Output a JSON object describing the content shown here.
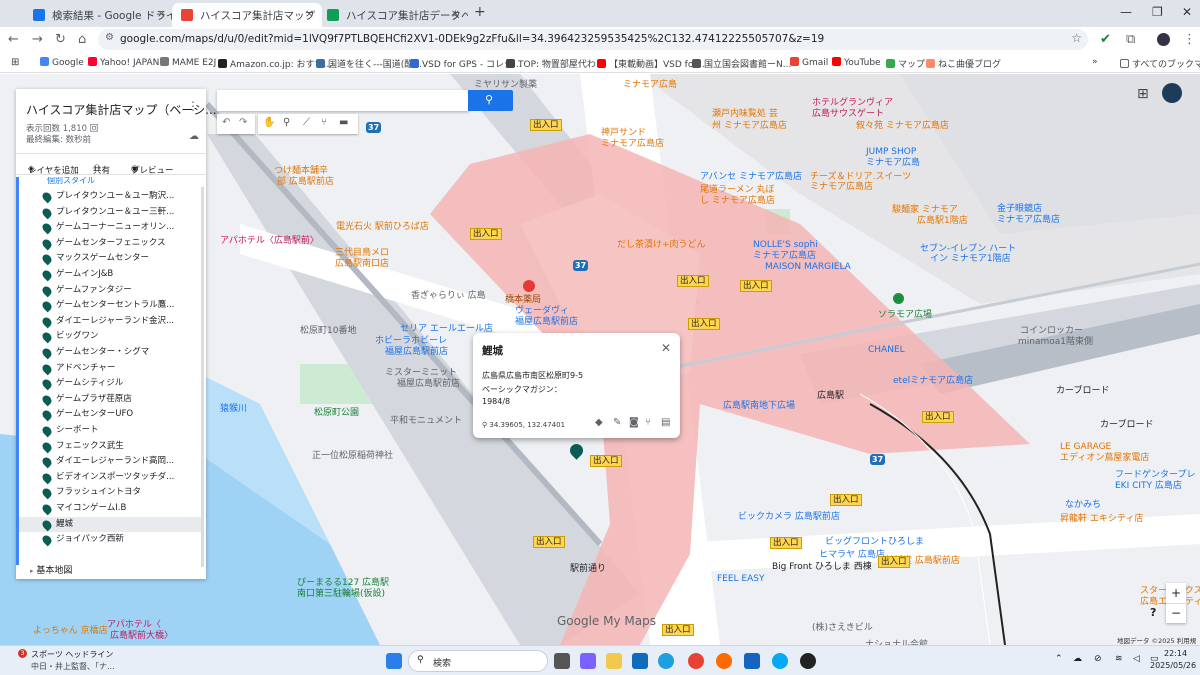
{
  "tabs": [
    {
      "title": "検索結果 - Google ドライブ",
      "color": "#1a73e8"
    },
    {
      "title": "ハイスコア集計店マップ（ベーシック",
      "color": "#ea4335"
    },
    {
      "title": "ハイスコア集計店データベース - Goo",
      "color": "#0f9d58"
    }
  ],
  "url": "google.com/maps/d/u/0/edit?mid=1lVQ9f7PTLBQEHCfi2XV1-0DEk9g2zFfu&ll=34.396423259535425%2C132.47412225505707&z=19",
  "bookmarks": [
    {
      "label": "Google",
      "color": "#4285f4"
    },
    {
      "label": "Yahoo! JAPAN",
      "color": "#ff0033"
    },
    {
      "label": "MAME E2J",
      "color": "#777777"
    },
    {
      "label": "Amazon.co.jp: おすす...",
      "color": "#222222"
    },
    {
      "label": "国道を往く---国道(酷...",
      "color": "#3b6ea5"
    },
    {
      "label": "VSD for GPS - コレジ...",
      "color": "#3367d6"
    },
    {
      "label": "TOP: 物置部屋代わり",
      "color": "#444444"
    },
    {
      "label": "【東載動画】VSD for...",
      "color": "#ff0000"
    },
    {
      "label": "国立国会図書館ーN...",
      "color": "#555555"
    },
    {
      "label": "Gmail",
      "color": "#ea4335"
    },
    {
      "label": "YouTube",
      "color": "#ff0000"
    },
    {
      "label": "マップ",
      "color": "#34a853"
    },
    {
      "label": "ねこ曲優ブログ",
      "color": "#ff8a65"
    }
  ],
  "bookmarks_all": "すべてのブックマーク",
  "panel": {
    "title": "ハイスコア集計店マップ（ベーシ...",
    "views": "表示回数 1,810 回",
    "edited": "最終編集: 数秒前",
    "add_layer": "レイヤを追加",
    "share": "共有",
    "preview": "プレビュー",
    "style_link": "個別スタイル",
    "items": [
      {
        "label": "プレイタウンユー＆ユー駒沢...",
        "color": "#0b5d53"
      },
      {
        "label": "プレイタウンユー＆ユー三軒...",
        "color": "#0b5d53"
      },
      {
        "label": "ゲームコーナーニューオリン...",
        "color": "#0b5d53"
      },
      {
        "label": "ゲームセンターフェニックス",
        "color": "#0b5d53"
      },
      {
        "label": "マックスゲームセンター",
        "color": "#0b5d53"
      },
      {
        "label": "ゲームインJ&B",
        "color": "#0b5d53"
      },
      {
        "label": "ゲームファンタジー",
        "color": "#0b5d53"
      },
      {
        "label": "ゲームセンターセントラル鷹...",
        "color": "#0b5d53"
      },
      {
        "label": "ダイエーレジャーランド金沢...",
        "color": "#0b5d53"
      },
      {
        "label": "ビッグワン",
        "color": "#0b5d53"
      },
      {
        "label": "ゲームセンター・シグマ",
        "color": "#0b5d53"
      },
      {
        "label": "アドベンチャー",
        "color": "#0b5d53"
      },
      {
        "label": "ゲームシティジル",
        "color": "#0b5d53"
      },
      {
        "label": "ゲームプラザ荏原店",
        "color": "#0b5d53"
      },
      {
        "label": "ゲームセンターUFO",
        "color": "#0b5d53"
      },
      {
        "label": "シーボート",
        "color": "#0b5d53"
      },
      {
        "label": "フェニックス武生",
        "color": "#0b5d53"
      },
      {
        "label": "ダイエーレジャーランド高岡...",
        "color": "#0b5d53"
      },
      {
        "label": "ビデオインスポーツタッチダ...",
        "color": "#0b5d53"
      },
      {
        "label": "フラッシュイントヨタ",
        "color": "#0b5d53"
      },
      {
        "label": "マイコンゲームI.B",
        "color": "#0b5d53"
      },
      {
        "label": "鯉城",
        "color": "#0b5d53",
        "selected": true
      },
      {
        "label": "ジョイパック西新",
        "color": "#0b5d53"
      }
    ],
    "basemap": "基本地図"
  },
  "popup": {
    "title": "鯉城",
    "address": "広島県広島市南区松原町9-5",
    "magazine": "ベーシックマガジン：",
    "date": "1984/8",
    "coords": "34.39605, 132.47401"
  },
  "map_labels": [
    {
      "t": "ミヤリサン製薬",
      "c": "gr"
    },
    {
      "t": "ミナモア広島",
      "c": "o"
    },
    {
      "t": "ホテルグランヴィア",
      "c": "p"
    },
    {
      "t": "広島サウスゲート",
      "c": "p"
    },
    {
      "t": "瀬戸内味覧処 芸",
      "c": "o"
    },
    {
      "t": "州 ミナモア広島店",
      "c": "o"
    },
    {
      "t": "叙々苑 ミナモア広島店",
      "c": "o"
    },
    {
      "t": "神戸サンド",
      "c": "o"
    },
    {
      "t": "ミナモア広島店",
      "c": "o"
    },
    {
      "t": "JUMP SHOP",
      "c": "b"
    },
    {
      "t": "ミナモア広島",
      "c": "b"
    },
    {
      "t": "つけ麺本舗辛",
      "c": "o"
    },
    {
      "t": "部 広島駅前店",
      "c": "o"
    },
    {
      "t": "アバンセ ミナモア広島店",
      "c": "b"
    },
    {
      "t": "チーズ＆ドリア.スイーツ",
      "c": "o"
    },
    {
      "t": "ミナモア広島店",
      "c": "o"
    },
    {
      "t": "尾道ラーメン 丸ぼ",
      "c": "o"
    },
    {
      "t": "し ミナモア広島店",
      "c": "o"
    },
    {
      "t": "駿麺家 ミナモア",
      "c": "o"
    },
    {
      "t": "広島駅1階店",
      "c": "o"
    },
    {
      "t": "金子眼鏡店",
      "c": "b"
    },
    {
      "t": "ミナモア広島店",
      "c": "b"
    },
    {
      "t": "電光石火 駅前ひろば店",
      "c": "o"
    },
    {
      "t": "アパホテル〈広島駅前〉",
      "c": "p"
    },
    {
      "t": "NOLLE'S sophi",
      "c": "b"
    },
    {
      "t": "ミナモア広島店",
      "c": "b"
    },
    {
      "t": "三代目鳥メロ",
      "c": "o"
    },
    {
      "t": "広島駅南口店",
      "c": "o"
    },
    {
      "t": "だし茶漬け+肉うどん",
      "c": "o"
    },
    {
      "t": "MAISON MARGIELA",
      "c": "b"
    },
    {
      "t": "セブン-イレブン ハート",
      "c": "b"
    },
    {
      "t": "イン ミナモア1階店",
      "c": "b"
    },
    {
      "t": "香ぎゃらりぃ 広島",
      "c": "gr"
    },
    {
      "t": "橋本薬局",
      "c": "r"
    },
    {
      "t": "ヴェーダヴィ",
      "c": "b"
    },
    {
      "t": "福屋広島駅前店",
      "c": "b"
    },
    {
      "t": "ソラモア広場",
      "c": "g"
    },
    {
      "t": "セリア エールエール店",
      "c": "b"
    },
    {
      "t": "ホビーラホビーレ",
      "c": "b"
    },
    {
      "t": "福屋広島駅前店",
      "c": "b"
    },
    {
      "t": "コインロッカー",
      "c": "gr"
    },
    {
      "t": "minamoa1階東側",
      "c": "gr"
    },
    {
      "t": "CHANEL",
      "c": "b"
    },
    {
      "t": "ミスターミニット",
      "c": "gr"
    },
    {
      "t": "福屋広島駅前店",
      "c": "gr"
    },
    {
      "t": "etelミナモア広島店",
      "c": "b"
    },
    {
      "t": "広島駅",
      "c": "dk"
    },
    {
      "t": "松原町公園",
      "c": "g"
    },
    {
      "t": "平和モニュメント",
      "c": "gr"
    },
    {
      "t": "広島駅南地下広場",
      "c": "b"
    },
    {
      "t": "カーブロード",
      "c": "dk"
    },
    {
      "t": "カーブロード",
      "c": "dk"
    },
    {
      "t": "正一位松原稲荷神社",
      "c": "gr"
    },
    {
      "t": "LE GARAGE",
      "c": "o"
    },
    {
      "t": "エディオン蔦屋家電店",
      "c": "o"
    },
    {
      "t": "フードゲンタープレ",
      "c": "b"
    },
    {
      "t": "EKI CITY 広島店",
      "c": "b"
    },
    {
      "t": "なかみち",
      "c": "b"
    },
    {
      "t": "昇龍軒 エキシティ店",
      "c": "o"
    },
    {
      "t": "ビックカメラ 広島駅前店",
      "c": "b"
    },
    {
      "t": "ビッグフロントひろしま",
      "c": "b"
    },
    {
      "t": "ヒマラヤ 広島店",
      "c": "b"
    },
    {
      "t": "鉄板堂 広島駅前店",
      "c": "o"
    },
    {
      "t": "FEEL EASY",
      "c": "b"
    },
    {
      "t": "Big Front ひろしま 西棟",
      "c": "dk"
    },
    {
      "t": "ぴーまるる127 広島駅",
      "c": "g"
    },
    {
      "t": "南口第三駐輪場(仮設)",
      "c": "g"
    },
    {
      "t": "スターバックス",
      "c": "o"
    },
    {
      "t": "広島エキシティ",
      "c": "o"
    },
    {
      "t": "よっちゃん 京橋店",
      "c": "o"
    },
    {
      "t": "アパホテル〈",
      "c": "p"
    },
    {
      "t": "広島駅前大橋〉",
      "c": "p"
    },
    {
      "t": "(株)さえきビル",
      "c": "gr"
    },
    {
      "t": "ナショナル会館",
      "c": "gr"
    },
    {
      "t": "松原町10番地",
      "c": "gr"
    },
    {
      "t": "駅前通り",
      "c": "dk"
    },
    {
      "t": "猿猴川",
      "c": "b"
    }
  ],
  "exits": [
    "出入口",
    "出入口",
    "出入口",
    "出入口",
    "出入口",
    "出入口",
    "出入口",
    "出入口",
    "出入口",
    "出入口",
    "出入口",
    "出入口"
  ],
  "routes": [
    "37",
    "37",
    "37"
  ],
  "map_footer": {
    "google": "Google My Maps",
    "attrib": "地図データ ©2025",
    "terms": "利用規約"
  },
  "taskbar": {
    "news_title": "スポーツ ヘッドライン",
    "news_sub": "中日・井上監督、「ナ...",
    "news_badge": "3",
    "search": "検索",
    "time": "22:14",
    "date": "2025/05/26"
  }
}
